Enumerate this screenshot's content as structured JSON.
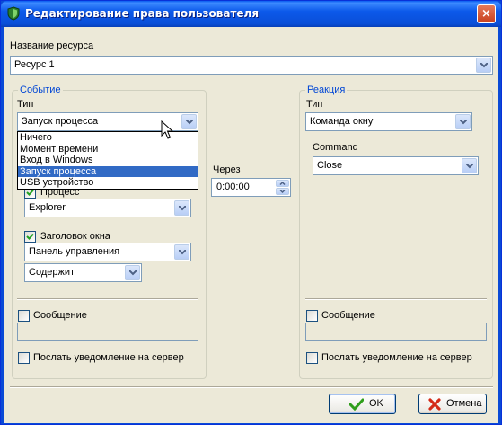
{
  "window": {
    "title": "Редактирование права пользователя",
    "close_glyph": "×"
  },
  "resource": {
    "label": "Название ресурса",
    "value": "Ресурс 1"
  },
  "event": {
    "group_title": "Событие",
    "type_label": "Тип",
    "type_value": "Запуск процесса",
    "dropdown_options": [
      "Ничего",
      "Момент времени",
      "Вход в Windows",
      "Запуск процесса",
      "USB устройство"
    ],
    "dropdown_selected_index": 3,
    "process_checkbox_label": "Процесс",
    "process_checked": true,
    "process_value": "Explorer",
    "window_title_checkbox_label": "Заголовок окна",
    "window_title_checked": true,
    "window_title_value": "Панель управления",
    "match_value": "Содержит",
    "message_checkbox_label": "Сообщение",
    "message_checked": false,
    "message_value": "",
    "notify_checkbox_label": "Послать уведомление на сервер",
    "notify_checked": false
  },
  "delay": {
    "label": "Через",
    "value": "0:00:00"
  },
  "reaction": {
    "group_title": "Реакция",
    "type_label": "Тип",
    "type_value": "Команда окну",
    "command_label": "Command",
    "command_value": "Close",
    "message_checkbox_label": "Сообщение",
    "message_checked": false,
    "message_value": "",
    "notify_checkbox_label": "Послать уведомление на сервер",
    "notify_checked": false
  },
  "buttons": {
    "ok_label": "OK",
    "cancel_label": "Отмена"
  },
  "colors": {
    "title_bar": "#0a4fd8",
    "dialog_bg": "#ece9d8",
    "group_title": "#0046d5",
    "selection": "#316ac5",
    "ok_icon": "#2f9e1b",
    "cancel_icon": "#d42a17"
  },
  "icons": {
    "app": "app-shield-icon",
    "close": "close-icon",
    "ok": "checkmark-icon",
    "cancel": "red-x-icon",
    "cursor": "mouse-pointer-icon"
  }
}
